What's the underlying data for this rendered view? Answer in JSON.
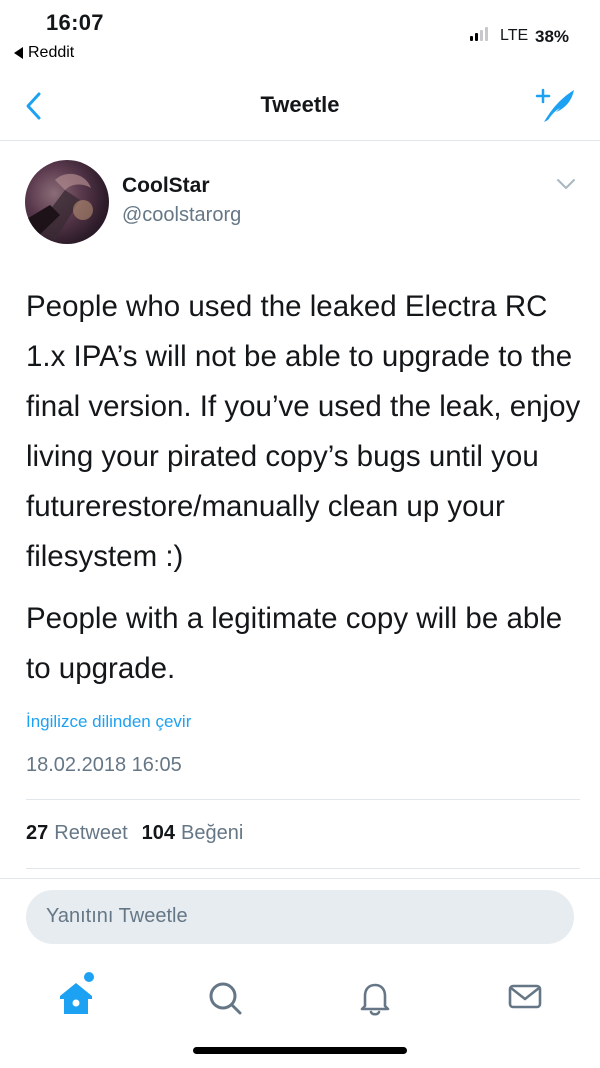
{
  "status_bar": {
    "time": "16:07",
    "back_app_label": "Reddit",
    "network": "LTE",
    "battery": "38%"
  },
  "nav": {
    "title": "Tweetle",
    "back_icon": "chevron-left-icon",
    "compose_icon": "compose-tweet-icon"
  },
  "tweet": {
    "author_name": "CoolStar",
    "author_handle": "@coolstarorg",
    "paragraphs": [
      "People who used the leaked Electra RC 1.x IPA’s will not be able to upgrade to the final version. If you’ve used the leak, enjoy living your pirated copy’s bugs until you futurerestore/manually clean up your filesystem :)",
      "People with a legitimate copy will be able to upgrade."
    ],
    "translate_label": "İngilizce dilinden çevir",
    "timestamp": "18.02.2018 16:05",
    "retweet_count": "27",
    "retweet_label": "Retweet",
    "like_count": "104",
    "like_label": "Beğeni"
  },
  "reply": {
    "placeholder": "Yanıtını Tweetle"
  },
  "tab_bar": {
    "items": [
      "home-icon",
      "search-icon",
      "notifications-icon",
      "messages-icon"
    ],
    "active": "home-icon"
  },
  "colors": {
    "accent": "#1da1f2",
    "secondary_text": "#657786",
    "reply_bg": "#e6ecf0"
  }
}
